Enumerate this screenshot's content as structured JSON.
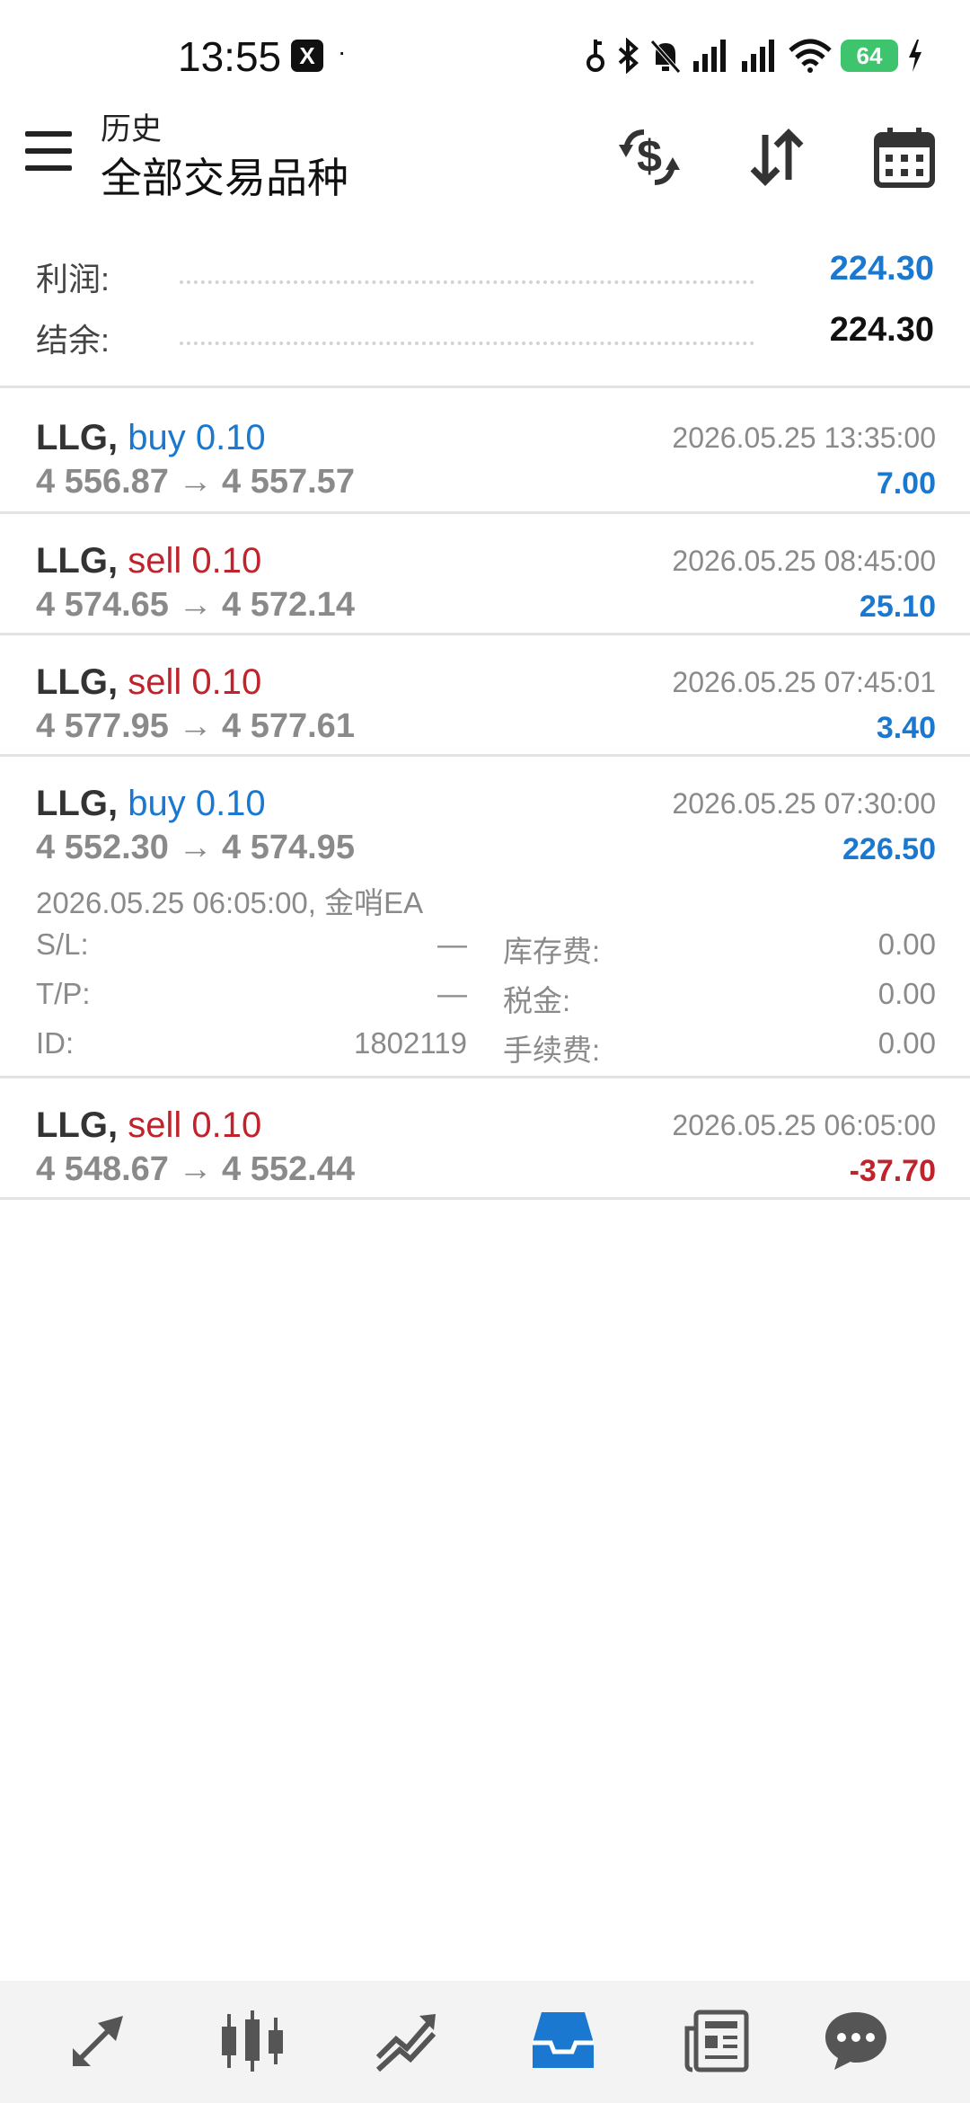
{
  "status_bar": {
    "time": "13:55",
    "app_icon": "X",
    "dot": "·",
    "battery": "64"
  },
  "header": {
    "subtitle": "历史",
    "title": "全部交易品种"
  },
  "summary": {
    "profit_label": "利润:",
    "profit_value": "224.30",
    "balance_label": "结余:",
    "balance_value": "224.30"
  },
  "deals": [
    {
      "symbol": "LLG,",
      "side": "buy 0.10",
      "prices": "4 556.87 → 4 557.57",
      "time": "2026.05.25 13:35:00",
      "profit": "7.00"
    },
    {
      "symbol": "LLG,",
      "side": "sell 0.10",
      "prices": "4 574.65 → 4 572.14",
      "time": "2026.05.25 08:45:00",
      "profit": "25.10"
    },
    {
      "symbol": "LLG,",
      "side": "sell 0.10",
      "prices": "4 577.95 → 4 577.61",
      "time": "2026.05.25 07:45:01",
      "profit": "3.40"
    },
    {
      "symbol": "LLG,",
      "side": "buy 0.10",
      "prices": "4 552.30 → 4 574.95",
      "time": "2026.05.25 07:30:00",
      "profit": "226.50",
      "open_info": "2026.05.25 06:05:00, 金哨EA",
      "details": {
        "sl_label": "S/L:",
        "sl_value": "—",
        "tp_label": "T/P:",
        "tp_value": "—",
        "id_label": "ID:",
        "id_value": "1802119",
        "swap_label": "库存费:",
        "swap_value": "0.00",
        "tax_label": "税金:",
        "tax_value": "0.00",
        "fee_label": "手续费:",
        "fee_value": "0.00"
      }
    },
    {
      "symbol": "LLG,",
      "side": "sell 0.10",
      "prices": "4 548.67 → 4 552.44",
      "time": "2026.05.25 06:05:00",
      "profit": "-37.70"
    }
  ],
  "colors": {
    "buy": "#1a78d0",
    "sell": "#c0232b",
    "profit_positive": "#1a78d0",
    "profit_negative": "#c0232b",
    "nav_active": "#1a78d0"
  },
  "bottom_nav": [
    "quotes-icon",
    "chart-icon",
    "trade-icon",
    "history-icon",
    "news-icon",
    "messages-icon"
  ]
}
